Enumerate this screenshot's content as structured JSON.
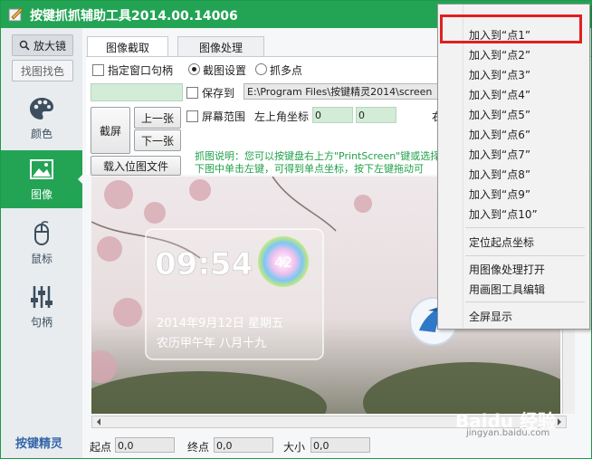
{
  "window": {
    "title": "按键抓抓辅助工具2014.00.14006"
  },
  "sidebar": {
    "magnifier_label": "放大镜",
    "find_color_label": "找图找色",
    "nav": [
      {
        "label": "颜色",
        "icon": "palette-icon"
      },
      {
        "label": "图像",
        "icon": "image-icon"
      },
      {
        "label": "鼠标",
        "icon": "mouse-icon"
      },
      {
        "label": "句柄",
        "icon": "sliders-icon"
      }
    ],
    "brand": "按键精灵"
  },
  "tabs": [
    {
      "label": "图像截取",
      "active": true
    },
    {
      "label": "图像处理",
      "active": false
    }
  ],
  "capture": {
    "specify_window_label": "指定窗口句柄",
    "capture_settings_label": "截图设置",
    "grab_multi_label": "抓多点",
    "save_to_label": "保存到",
    "save_path": "E:\\Program Files\\按键精灵2014\\screen",
    "screen_range_label": "屏幕范围",
    "top_left_label": "左上角坐标",
    "top_left_x": "0",
    "top_left_y": "0",
    "right_label": "右",
    "capture_button": "截屏",
    "prev_button": "上一张",
    "next_button": "下一张",
    "load_image_button": "载入位图文件",
    "hint_line1": "抓图说明：您可以按键盘右上方\"PrintScreen\"键或选择",
    "hint_line2": "下图中单击左键，可得到单点坐标，按下左键拖动可"
  },
  "wallpaper": {
    "clock": "09:54",
    "badge": "42",
    "date": "2014年9月12日 星期五",
    "lunar": "农历甲午年 八月十九"
  },
  "bottom": {
    "start_label": "起点",
    "start_value": "0,0",
    "end_label": "终点",
    "end_value": "0,0",
    "size_label": "大小",
    "size_value": "0,0"
  },
  "context_menu": {
    "add_points": [
      "加入到“点1”",
      "加入到“点2”",
      "加入到“点3”",
      "加入到“点4”",
      "加入到“点5”",
      "加入到“点6”",
      "加入到“点7”",
      "加入到“点8”",
      "加入到“点9”",
      "加入到“点10”"
    ],
    "locate_start": "定位起点坐标",
    "open_with_processing": "用图像处理打开",
    "edit_with_paint": "用画图工具编辑",
    "fullscreen": "全屏显示"
  },
  "watermark": {
    "brand": "Baidu 经验",
    "url": "jingyan.baidu.com"
  },
  "colors": {
    "accent_green": "#23a455",
    "highlight_red": "#e02020"
  }
}
